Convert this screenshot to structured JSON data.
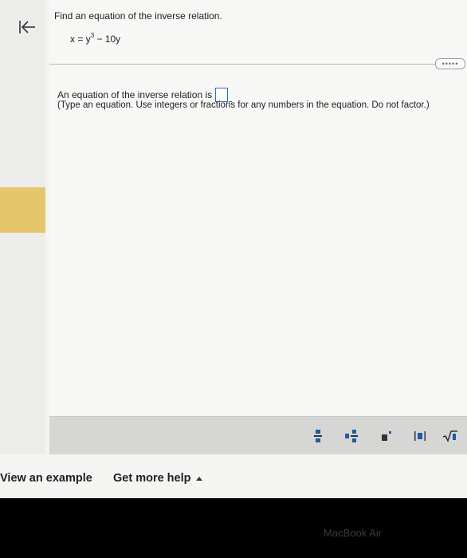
{
  "question": {
    "prompt": "Find an equation of the inverse relation.",
    "equation_lhs": "x = y",
    "equation_exp": "3",
    "equation_rhs": " − 10y"
  },
  "answer": {
    "lead_text": "An equation of the inverse relation is",
    "instructions": "(Type an equation. Use integers or fractions for any numbers in the equation. Do not factor.)"
  },
  "toolbar": {
    "more_label": "•••••",
    "tools": [
      "fraction-icon",
      "mixed-number-icon",
      "exponent-icon",
      "absolute-value-icon",
      "square-root-icon"
    ]
  },
  "footer": {
    "view_example": "View an example",
    "get_more_help": "Get more help"
  },
  "device": {
    "bezel_label": "MacBook Air"
  },
  "colors": {
    "highlight": "#e5c66a",
    "input_border": "#2d6fc1"
  }
}
